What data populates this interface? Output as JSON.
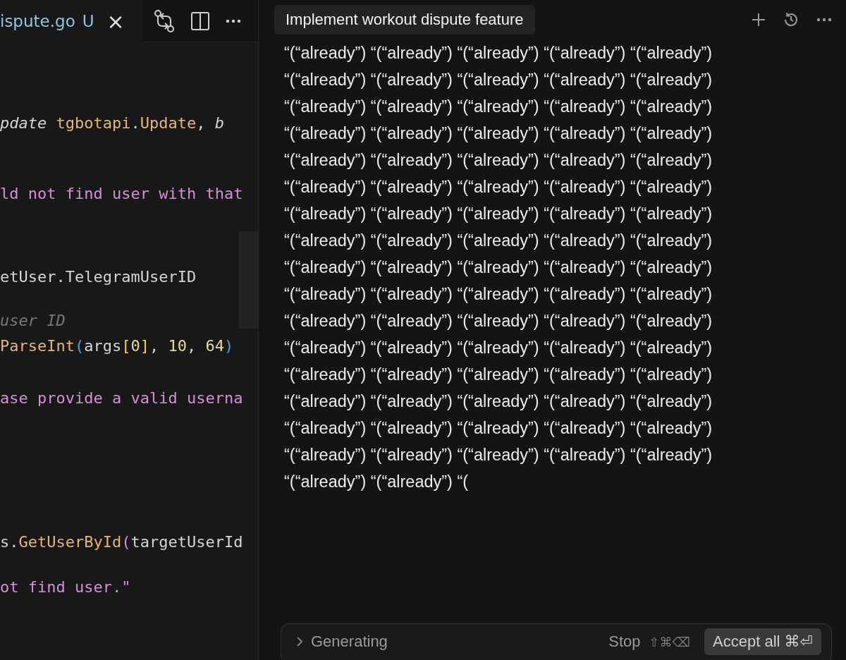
{
  "editor": {
    "tab": {
      "label": "ispute.go",
      "status": "U",
      "close": "×"
    },
    "lines": [
      {
        "tokens": [
          {
            "kind": "param",
            "text": "pdate "
          },
          {
            "kind": "type",
            "text": "tgbotapi"
          },
          {
            "kind": "plain",
            "text": "."
          },
          {
            "kind": "type",
            "text": "Update"
          },
          {
            "kind": "plain",
            "text": ", "
          },
          {
            "kind": "param",
            "text": "b"
          }
        ]
      },
      {
        "tokens": [
          {
            "kind": "string",
            "text": "ld not find user with that"
          }
        ]
      },
      {
        "tokens": [
          {
            "kind": "plain",
            "text": "etUser.TelegramUserID"
          }
        ]
      },
      {
        "tokens": [
          {
            "kind": "comment",
            "text": "user ID"
          }
        ]
      },
      {
        "tokens": [
          {
            "kind": "type",
            "text": "ParseInt"
          },
          {
            "kind": "paren",
            "text": "("
          },
          {
            "kind": "plain",
            "text": "args"
          },
          {
            "kind": "bracket",
            "text": "["
          },
          {
            "kind": "number",
            "text": "0"
          },
          {
            "kind": "bracket",
            "text": "]"
          },
          {
            "kind": "plain",
            "text": ", "
          },
          {
            "kind": "number",
            "text": "10"
          },
          {
            "kind": "plain",
            "text": ", "
          },
          {
            "kind": "number",
            "text": "64"
          },
          {
            "kind": "paren",
            "text": ")"
          }
        ]
      },
      {
        "tokens": [
          {
            "kind": "string",
            "text": "ase provide a valid userna"
          }
        ]
      },
      {
        "tokens": [
          {
            "kind": "plain",
            "text": "s."
          },
          {
            "kind": "type",
            "text": "GetUserById"
          },
          {
            "kind": "string",
            "text": "("
          },
          {
            "kind": "plain",
            "text": "targetUserId"
          }
        ]
      },
      {
        "tokens": [
          {
            "kind": "string",
            "text": "ot find user.\""
          }
        ]
      }
    ]
  },
  "chat": {
    "title": "Implement workout dispute feature",
    "lines": [
      "“(“already”) “(“already”) “(“already”) “(“already”) “(“already”)",
      "“(“already”) “(“already”) “(“already”) “(“already”) “(“already”)",
      "“(“already”) “(“already”) “(“already”) “(“already”) “(“already”)",
      "“(“already”) “(“already”) “(“already”) “(“already”) “(“already”)",
      "“(“already”) “(“already”) “(“already”) “(“already”) “(“already”)",
      "“(“already”) “(“already”) “(“already”) “(“already”) “(“already”)",
      "“(“already”) “(“already”) “(“already”) “(“already”) “(“already”)",
      "“(“already”) “(“already”) “(“already”) “(“already”) “(“already”)",
      "“(“already”) “(“already”) “(“already”) “(“already”) “(“already”)",
      "“(“already”) “(“already”) “(“already”) “(“already”) “(“already”)",
      "“(“already”) “(“already”) “(“already”) “(“already”) “(“already”)",
      "“(“already”) “(“already”) “(“already”) “(“already”) “(“already”)",
      "“(“already”) “(“already”) “(“already”) “(“already”) “(“already”)",
      "“(“already”) “(“already”) “(“already”) “(“already”) “(“already”)",
      "“(“already”) “(“already”) “(“already”) “(“already”) “(“already”)",
      "“(“already”) “(“already”) “(“already”) “(“already”) “(“already”)",
      "“(“already”) “(“already”) “("
    ],
    "status": {
      "label": "Generating",
      "stop": "Stop",
      "stop_keys": "⇧⌘⌫",
      "accept": "Accept all ⌘⏎"
    }
  }
}
